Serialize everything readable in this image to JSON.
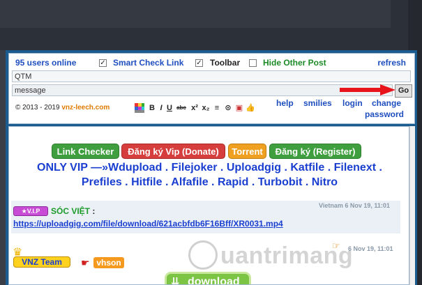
{
  "chatbar": {
    "users_online": "95 users online",
    "smart_check_link": {
      "label": "Smart Check Link",
      "checked": true
    },
    "toolbar": {
      "label": "Toolbar",
      "checked": true
    },
    "hide_other_post": {
      "label": "Hide Other Post",
      "checked": false
    },
    "refresh_label": "refresh",
    "name_value": "QTM",
    "message_value": "message",
    "go_label": "Go",
    "copyright": "© 2013 - 2019",
    "site": "vnz-leech.com",
    "format_tools": [
      "B",
      "I",
      "U",
      "abc",
      "x²",
      "x₂",
      "≡",
      "⊙",
      "▣",
      "👍"
    ],
    "links": {
      "help": "help",
      "smilies": "smilies",
      "login": "login",
      "change": "change",
      "password": "password"
    }
  },
  "buttons": {
    "link_checker": "Link Checker",
    "vip": "Đăng ký Vip (Donate)",
    "torrent": "Torrent",
    "register": "Đăng ký (Register)"
  },
  "promo": {
    "line1": "ONLY VIP —»Wdupload . Filejoker . Uploadgig . Katfile . Filenext .",
    "line2": "Prefiles . Hitfile . Alfafile . Rapid . Turbobit . Nitro"
  },
  "posts": [
    {
      "badge": "V.I.P",
      "username": "SÓC VIỆT",
      "separator": ":",
      "timestamp": "Vietnam 6 Nov 19, 11:01",
      "link": "https://uploadgig.com/file/download/621acbfdb6F16Bff/XR0031.mp4"
    },
    {
      "badge": "VNZ Team",
      "username": "vhson",
      "separator": ":",
      "timestamp": "6 Nov 19, 11:01",
      "button": "download"
    }
  ],
  "watermark": "uantrimang",
  "colors": {
    "panel_blue": "#1c5b8d",
    "link_blue": "#1f4fbf",
    "green": "#1c8a26",
    "arrow_red": "#e8141b"
  }
}
